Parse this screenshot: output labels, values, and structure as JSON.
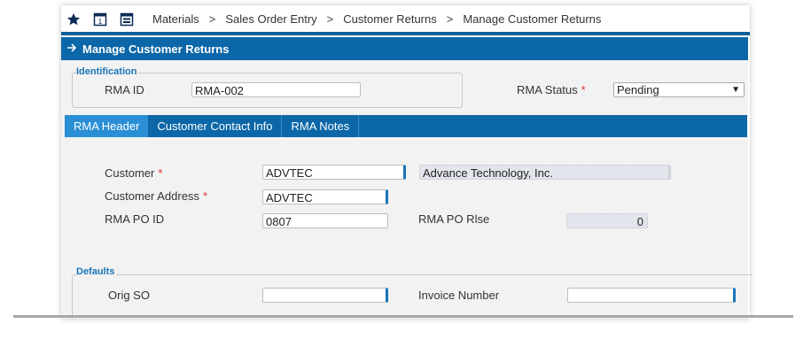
{
  "breadcrumb": [
    "Materials",
    "Sales Order Entry",
    "Customer Returns",
    "Manage Customer Returns"
  ],
  "breadcrumb_separator": ">",
  "toolbar_icons": [
    "star-icon",
    "calendar-icon",
    "layout-icon"
  ],
  "page_title": "Manage Customer Returns",
  "identification": {
    "legend": "Identification",
    "rma_id_label": "RMA ID",
    "rma_id_value": "RMA-002",
    "rma_status_label": "RMA Status",
    "rma_status_value": "Pending"
  },
  "tabs": [
    {
      "label": "RMA Header",
      "active": true
    },
    {
      "label": "Customer Contact Info",
      "active": false
    },
    {
      "label": "RMA Notes",
      "active": false
    }
  ],
  "header": {
    "customer_label": "Customer",
    "customer_value": "ADVTEC",
    "customer_name": "Advance Technology, Inc.",
    "customer_address_label": "Customer Address",
    "customer_address_value": "ADVTEC",
    "rma_po_id_label": "RMA PO ID",
    "rma_po_id_value": "0807",
    "rma_po_rlse_label": "RMA PO Rlse",
    "rma_po_rlse_value": "0"
  },
  "defaults": {
    "legend": "Defaults",
    "orig_so_label": "Orig SO",
    "orig_so_value": "",
    "invoice_number_label": "Invoice Number",
    "invoice_number_value": ""
  },
  "required_marker": "*",
  "colors": {
    "primary": "#0c67a8",
    "active_tab": "#2a8fd4",
    "legend": "#1a75b8",
    "required": "#d33"
  }
}
